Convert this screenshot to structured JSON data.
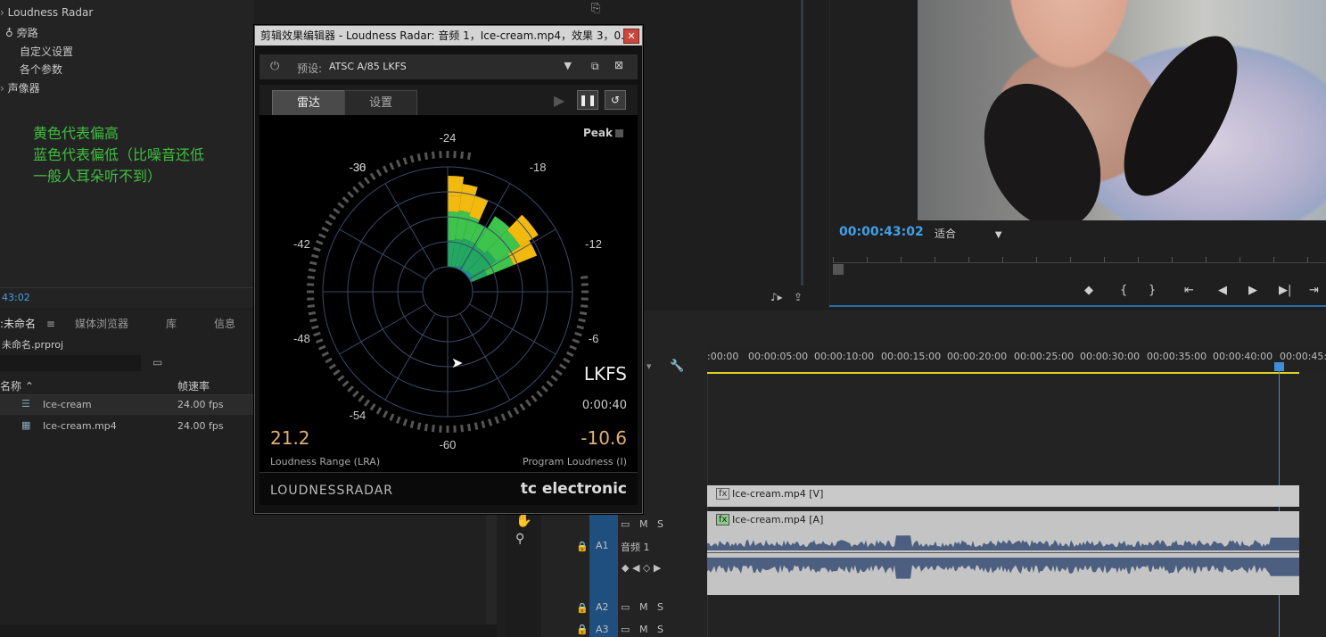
{
  "effect_panel": {
    "header": "Loudness Radar",
    "bypass": "旁路",
    "custom": "自定义设置",
    "params": "各个参数",
    "panner": "声像器",
    "timecode": "43:02",
    "annotation_lines": [
      "黄色代表偏高",
      "蓝色代表偏低（比噪音还低",
      "一般人耳朵听不到）"
    ]
  },
  "monitor": {
    "timecode": "00:00:43:02",
    "fit": "适合",
    "transport": [
      "◆",
      "{",
      "}",
      "⇤",
      "◀",
      "▶",
      "▶|",
      "⇥"
    ]
  },
  "project": {
    "tabs": [
      ":未命名",
      "媒体浏览器",
      "库",
      "信息"
    ],
    "project_file": "未命名.prproj",
    "col_name": "名称",
    "col_fps": "帧速率",
    "items": [
      {
        "name": "Ice-cream",
        "fps": "24.00 fps"
      },
      {
        "name": "Ice-cream.mp4",
        "fps": "24.00 fps"
      }
    ]
  },
  "timeline": {
    "ruler": [
      ":00:00",
      "00:00:05:00",
      "00:00:10:00",
      "00:00:15:00",
      "00:00:20:00",
      "00:00:25:00",
      "00:00:30:00",
      "00:00:35:00",
      "00:00:40:00",
      "00:00:45:0"
    ],
    "video_clip": "Ice-cream.mp4 [V]",
    "audio_clip": "Ice-cream.mp4 [A]",
    "tracks": {
      "a1": "A1",
      "a1_name": "音频 1",
      "a2": "A2",
      "a3": "A3"
    },
    "mute": "M",
    "solo": "S"
  },
  "radar_window": {
    "title": "剪辑效果编辑器 - Loudness Radar: 音频 1，Ice-cream.mp4，效果 3，0...",
    "preset_label": "预设:",
    "preset_value": "ATSC A/85 LKFS",
    "tab_radar": "雷达",
    "tab_settings": "设置",
    "peak": "Peak",
    "unit": "LKFS",
    "time": "0:00:40",
    "lra_value": "21.2",
    "lra_label": "Loudness Range (LRA)",
    "program_value": "-10.6",
    "program_label": "Program Loudness (I)",
    "brand_left": "LOUDNESSRADAR",
    "brand_right": "tc electronic",
    "scale": [
      "-24",
      "-18",
      "-12",
      "-6",
      "-60",
      "-54",
      "-48",
      "-42",
      "-36",
      "-30"
    ],
    "colors": {
      "yellow": "#f2b90f",
      "green_light": "#3ec44c",
      "green": "#23a862",
      "teal": "#1d8fa0"
    }
  }
}
